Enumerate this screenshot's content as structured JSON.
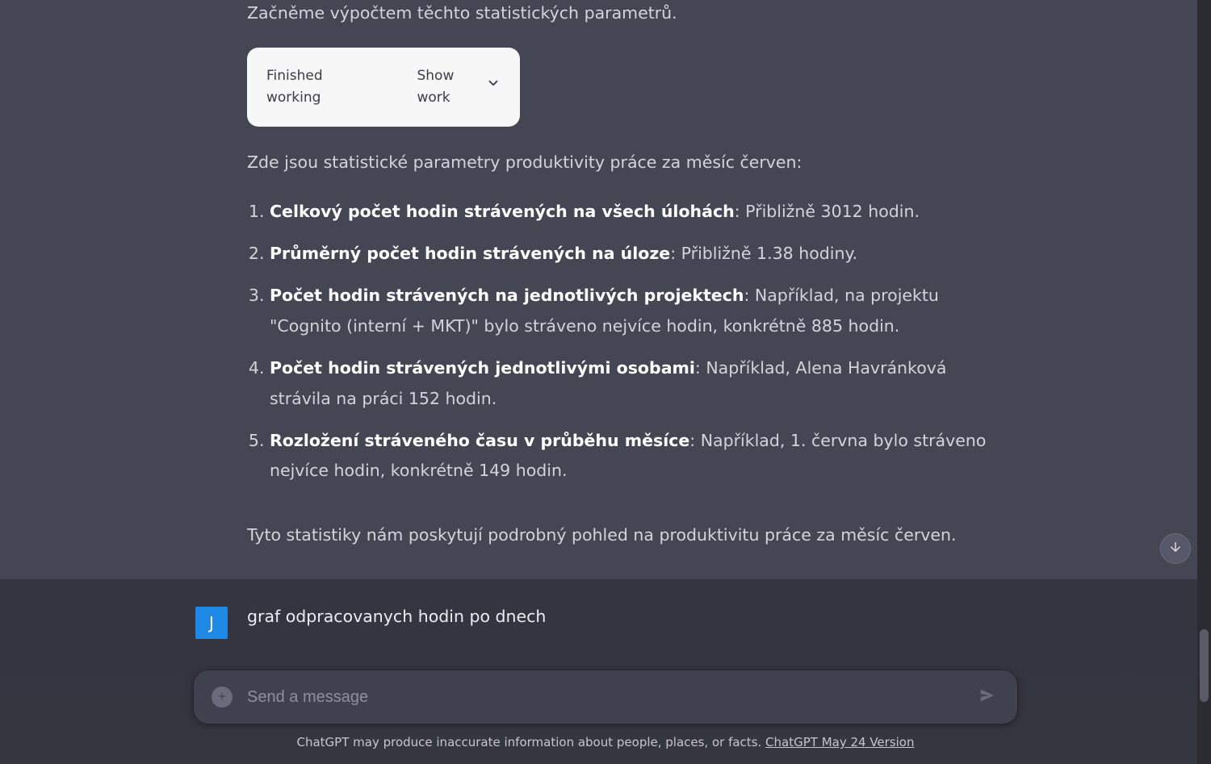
{
  "assistant": {
    "intro1": "Začněme výpočtem těchto statistických parametrů.",
    "code_status": "Finished working",
    "code_toggle": "Show work",
    "intro2": "Zde jsou statistické parametry produktivity práce za měsíc červen:",
    "items": [
      {
        "bold": "Celkový počet hodin strávených na všech úlohách",
        "rest": ": Přibližně 3012 hodin."
      },
      {
        "bold": "Průměrný počet hodin strávených na úloze",
        "rest": ": Přibližně 1.38 hodiny."
      },
      {
        "bold": "Počet hodin strávených na jednotlivých projektech",
        "rest": ": Například, na projektu \"Cognito (interní + MKT)\" bylo stráveno nejvíce hodin, konkrétně 885 hodin."
      },
      {
        "bold": "Počet hodin strávených jednotlivými osobami",
        "rest": ": Například, Alena Havránková strávila na práci 152 hodin."
      },
      {
        "bold": "Rozložení stráveného času v průběhu měsíce",
        "rest": ": Například, 1. června bylo stráveno nejvíce hodin, konkrétně 149 hodin."
      }
    ],
    "closing": "Tyto statistiky nám poskytují podrobný pohled na produktivitu práce za měsíc červen."
  },
  "user": {
    "avatar_letter": "J",
    "text": "graf odpracovanych hodin po dnech"
  },
  "composer": {
    "placeholder": "Send a message"
  },
  "footer": {
    "note_prefix": "ChatGPT may produce inaccurate information about people, places, or facts. ",
    "version_link": "ChatGPT May 24 Version"
  }
}
